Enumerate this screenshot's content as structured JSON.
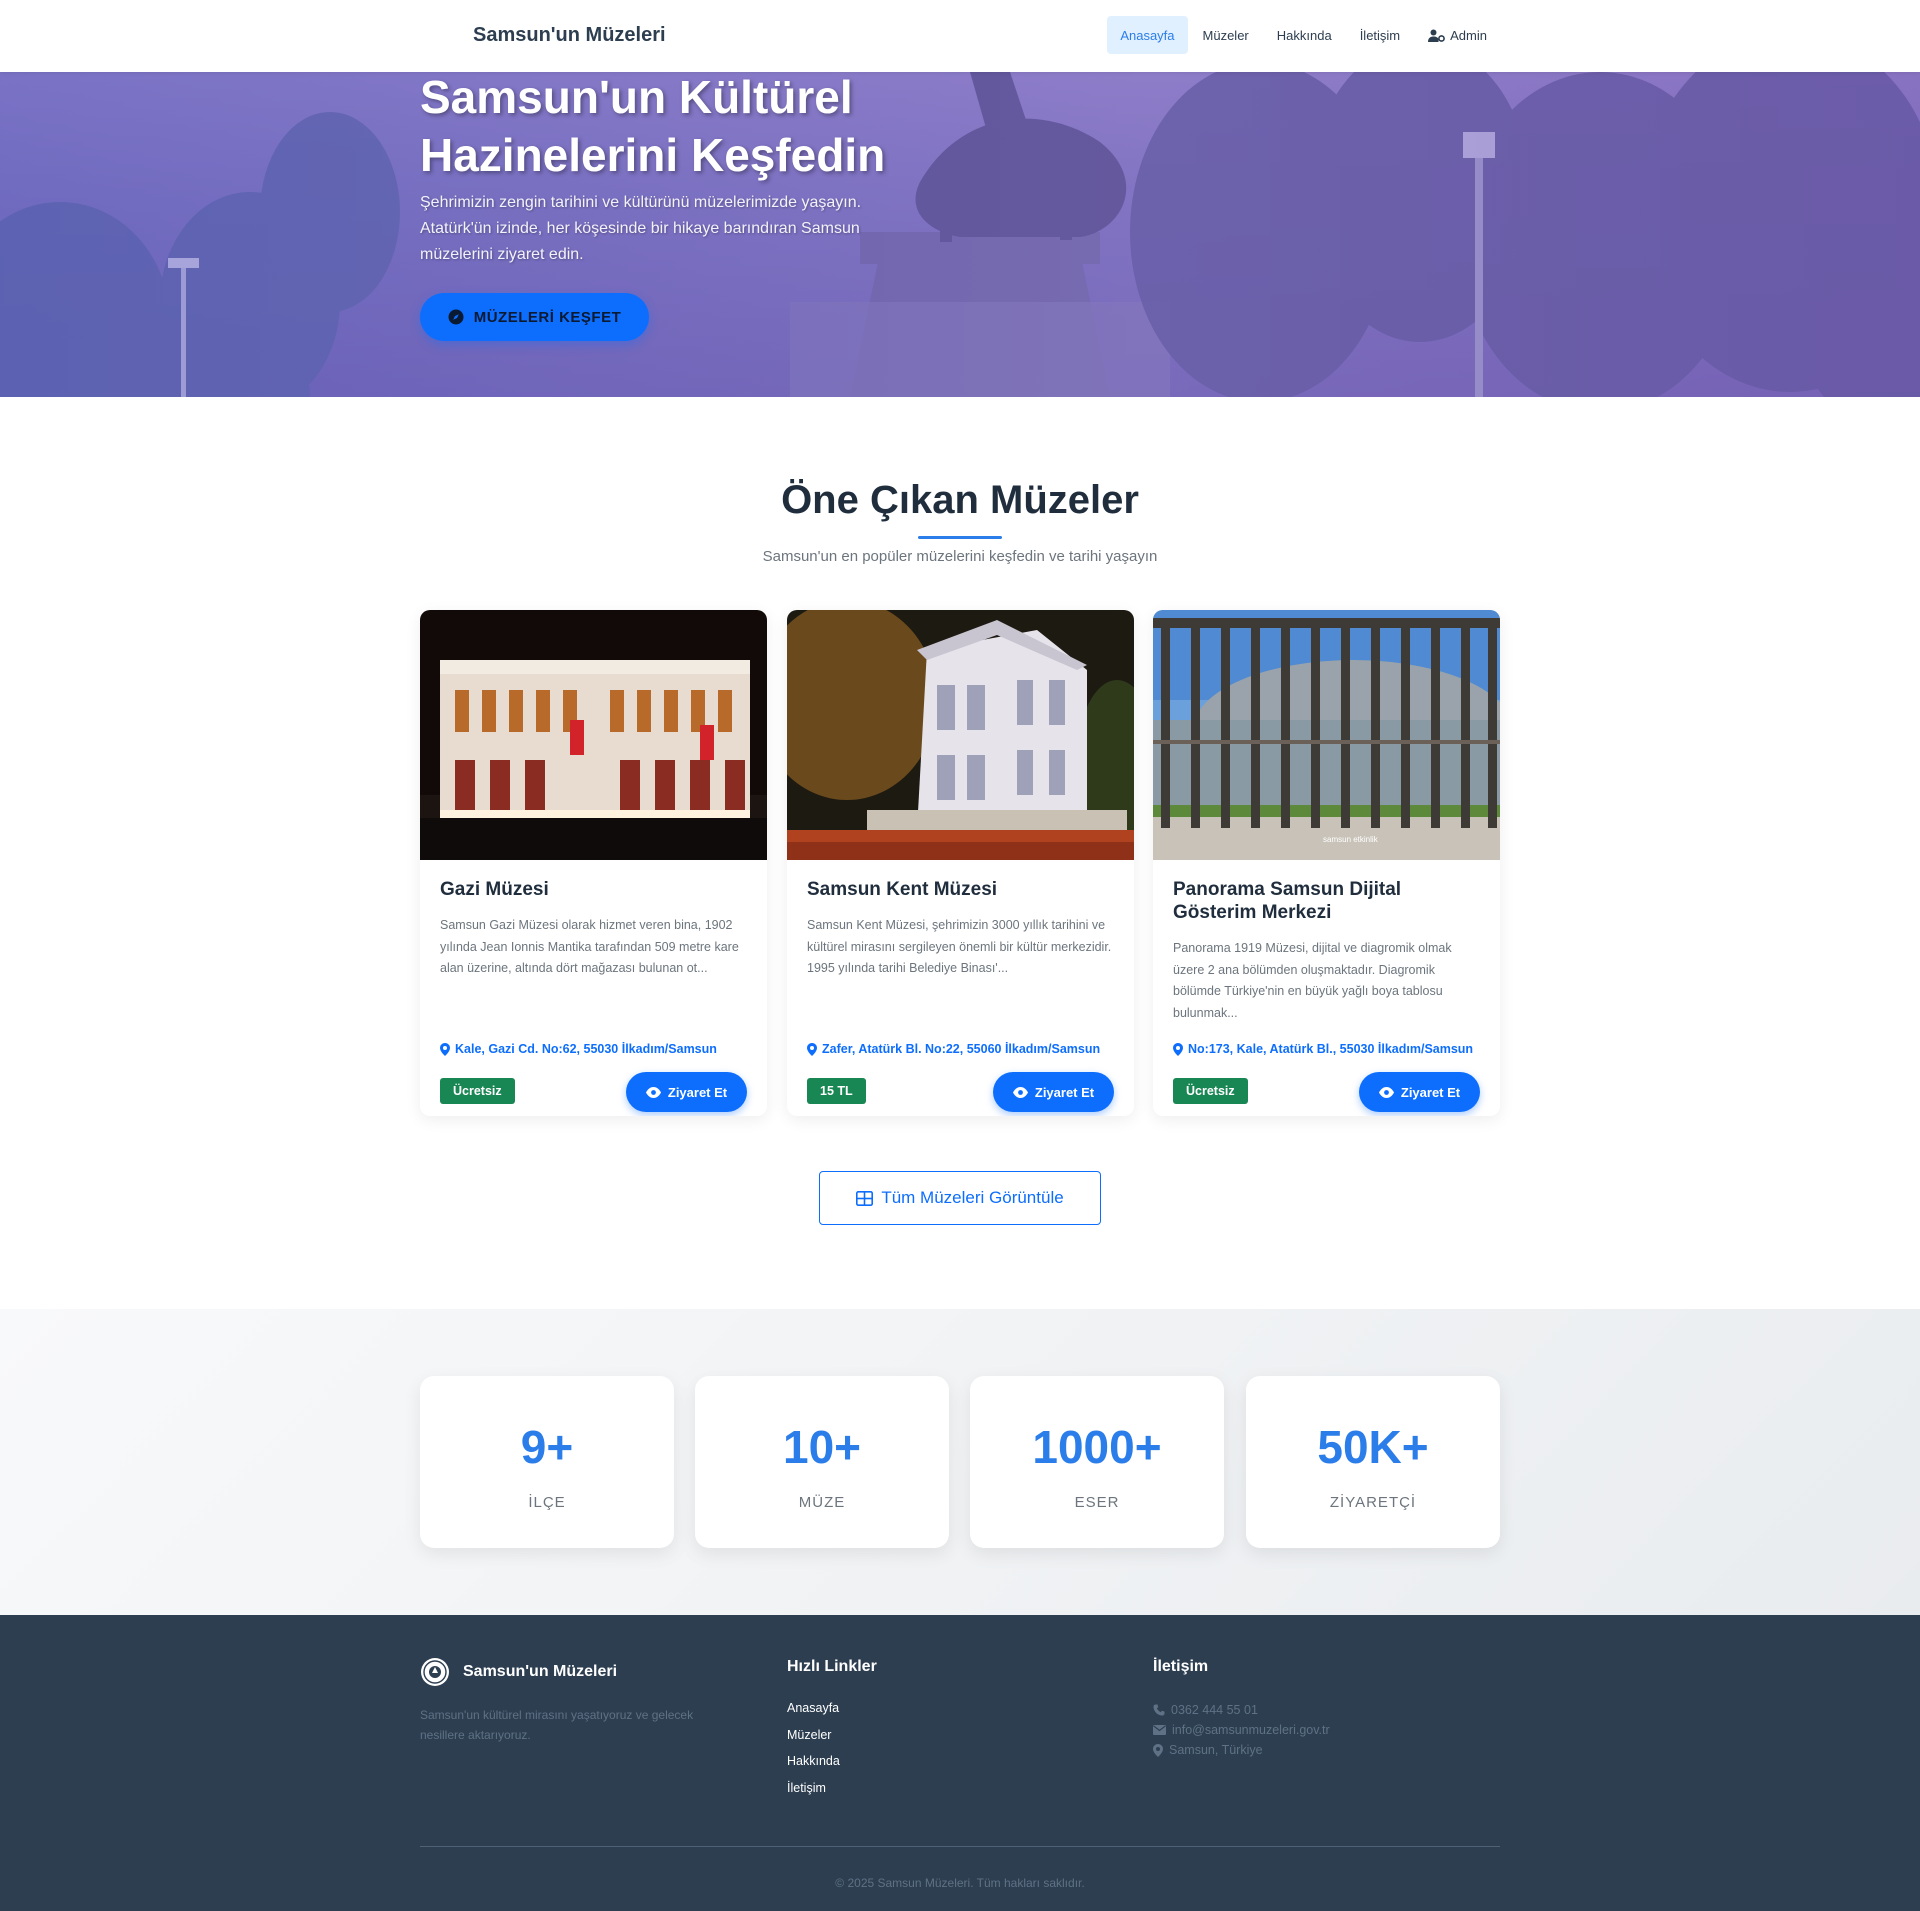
{
  "brand": "Samsun'un Müzeleri",
  "nav": [
    {
      "label": "Anasayfa",
      "active": true
    },
    {
      "label": "Müzeler"
    },
    {
      "label": "Hakkında"
    },
    {
      "label": "İletişim"
    },
    {
      "label": "Admin",
      "icon": "user-gear-icon"
    }
  ],
  "hero": {
    "title": "Samsun'un Kültürel Hazinelerini Keşfedin",
    "description": "Şehrimizin zengin tarihini ve kültürünü müzelerimizde yaşayın. Atatürk'ün izinde, her köşesinde bir hikaye barındıran Samsun müzelerini ziyaret edin.",
    "cta_label": "MÜZELERİ KEŞFET",
    "cta_icon": "compass-icon"
  },
  "featured": {
    "title": "Öne Çıkan Müzeler",
    "subtitle": "Samsun'un en popüler müzelerini keşfedin ve tarihi yaşayın",
    "museums": [
      {
        "name": "Gazi Müzesi",
        "description": "Samsun Gazi Müzesi olarak hizmet veren bina, 1902 yılında Jean Ionnis Mantika tarafından 509 metre kare alan üzerine, altında dört mağazası bulunan ot...",
        "address": "Kale, Gazi Cd. No:62, 55030 İlkadım/Samsun",
        "price": "Ücretsiz",
        "visit_label": "Ziyaret Et"
      },
      {
        "name": "Samsun Kent Müzesi",
        "description": "Samsun Kent Müzesi, şehrimizin 3000 yıllık tarihini ve kültürel mirasını sergileyen önemli bir kültür merkezidir. 1995 yılında tarihi Belediye Binası'...",
        "address": "Zafer, Atatürk Bl. No:22, 55060 İlkadım/Samsun",
        "price": "15 TL",
        "visit_label": "Ziyaret Et"
      },
      {
        "name": "Panorama Samsun Dijital Gösterim Merkezi",
        "description": "Panorama 1919 Müzesi, dijital ve diagromik olmak üzere 2 ana bölümden oluşmaktadır. Diagromik bölümde Türkiye'nin en büyük yağlı boya tablosu bulunmak...",
        "address": "No:173, Kale, Atatürk Bl., 55030 İlkadım/Samsun",
        "price": "Ücretsiz",
        "visit_label": "Ziyaret Et",
        "watermark": "samsun etkinlik"
      }
    ],
    "all_button_label": "Tüm Müzeleri Görüntüle"
  },
  "stats": [
    {
      "number": "9+",
      "label": "İLÇE"
    },
    {
      "number": "10+",
      "label": "MÜZE"
    },
    {
      "number": "1000+",
      "label": "ESER"
    },
    {
      "number": "50K+",
      "label": "ZİYARETÇİ"
    }
  ],
  "footer": {
    "brand": "Samsun'un Müzeleri",
    "description": "Samsun'un kültürel mirasını yaşatıyoruz ve gelecek nesillere aktarıyoruz.",
    "links_title": "Hızlı Linkler",
    "links": [
      "Anasayfa",
      "Müzeler",
      "Hakkında",
      "İletişim"
    ],
    "contact_title": "İletişim",
    "phone": "0362 444 55 01",
    "email": "info@samsunmuzeleri.gov.tr",
    "location": "Samsun, Türkiye",
    "copyright": "© 2025 Samsun Müzeleri. Tüm hakları saklıdır."
  },
  "colors": {
    "primary": "#0d6efd",
    "accent": "#2b7de9",
    "success": "#198754",
    "dark": "#2c3e50",
    "hero_purple": "#7b79c0"
  }
}
